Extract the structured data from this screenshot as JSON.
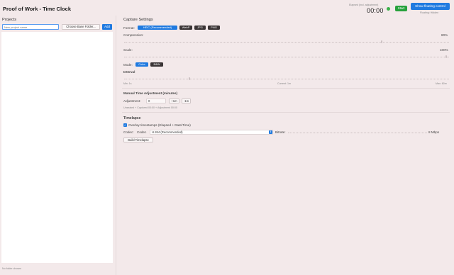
{
  "window": {
    "title": "Proof of Work - Time Clock"
  },
  "header": {
    "elapsed_label": "Elapsed (incl. adjustment)",
    "elapsed_value": "00:00",
    "start_label": "Start",
    "floating_button_label": "Show floating control",
    "floating_status": "Floating: Hidden",
    "colors": {
      "start": "#27a13c",
      "accent": "#1f7ae0"
    }
  },
  "projects": {
    "label": "Projects",
    "new_placeholder": "New project name",
    "choose_folder_label": "Choose Base Folder...",
    "add_label": "Add",
    "footer": "No folder chosen"
  },
  "capture": {
    "heading": "Capture Settings",
    "format_label": "Format:",
    "formats": [
      "HEIC (Recommended)",
      "WebP",
      "JPG",
      "PNG"
    ],
    "selected_format": "HEIC (Recommended)",
    "compression_label": "Compression:",
    "compression_value": "80%",
    "compression_level": 0.8,
    "scale_label": "Scale:",
    "scale_value": "100%",
    "scale_level": 1.0,
    "mode_label": "Mode:",
    "modes": [
      "Color",
      "B&W"
    ],
    "selected_mode": "Color",
    "interval_label": "Interval",
    "interval_min": "Min: 1s",
    "interval_current": "Current: 1m",
    "interval_max": "Max: 60m",
    "interval_level": 0.2
  },
  "manual": {
    "heading": "Manual Time Adjustment (minutes)",
    "adjustment_label": "Adjustment:",
    "adjustment_value": "0",
    "plus_label": "+1m",
    "minus_label": "-1m",
    "summary": "Unsealed + Captured 00:00 + Adjustment 00:00"
  },
  "timelapse": {
    "heading": "Timelapse",
    "overlay_label": "Overlay timestamps (Elapsed + Date/Time)",
    "overlay_checked": true,
    "codec_label": "Codec:",
    "codec_inner_label": "Codec",
    "codec_value": "H.264 (Recommended)",
    "bitrate_label": "Bitrate:",
    "bitrate_value": "8 Mbps",
    "bitrate_level": 1.0,
    "build_label": "Build Timelapse"
  }
}
